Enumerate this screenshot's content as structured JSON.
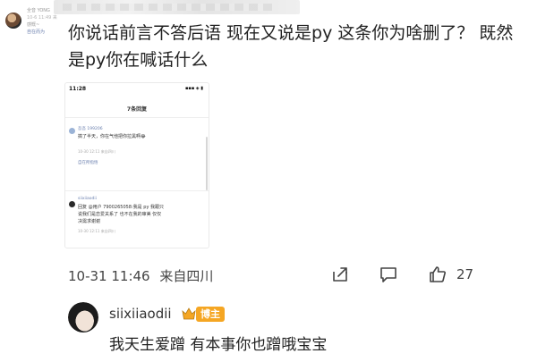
{
  "author": {
    "name": "全音 YONG",
    "sub": "10-6 11:49 来",
    "line2": "感慨~",
    "link": "自在而为"
  },
  "comment": {
    "text": "你说话前言不答后语 现在又说是py 这条你为啥删了？ 既然是py你在喊话什么",
    "time": "10-31 11:46",
    "location": "来自四川",
    "like_count": "27"
  },
  "screenshot": {
    "time": "11:28",
    "signal": "▪▪▪ ◈ ▮",
    "title": "7条回复",
    "c1_name": "吾吾 199206",
    "c1_text": "搞了半天，你在气他把你拉黑啊😂",
    "c1_time": "10-30 12:11  来自四川",
    "c1_reply": "自在所指悟",
    "c2_name": "siixiiaodii",
    "c2_text1": "回复 @用户 7900265058:我是 py  我跟只",
    "c2_text2": "说我们是恋爱关系了 也不在我的审美 仅仅",
    "c2_text3": "决需求谢谢",
    "c2_time": "10-30 12:11  来自四川"
  },
  "reply": {
    "username": "siixiiaodii",
    "badge": "博主",
    "text": "我天生爱蹭 有本事你也蹭哦宝宝"
  },
  "colors": {
    "link": "#6a7fae",
    "badge": "#f5a623",
    "text": "#222222",
    "meta": "#444444"
  },
  "icons": [
    "share-icon",
    "comment-icon",
    "like-icon",
    "crown-icon"
  ]
}
